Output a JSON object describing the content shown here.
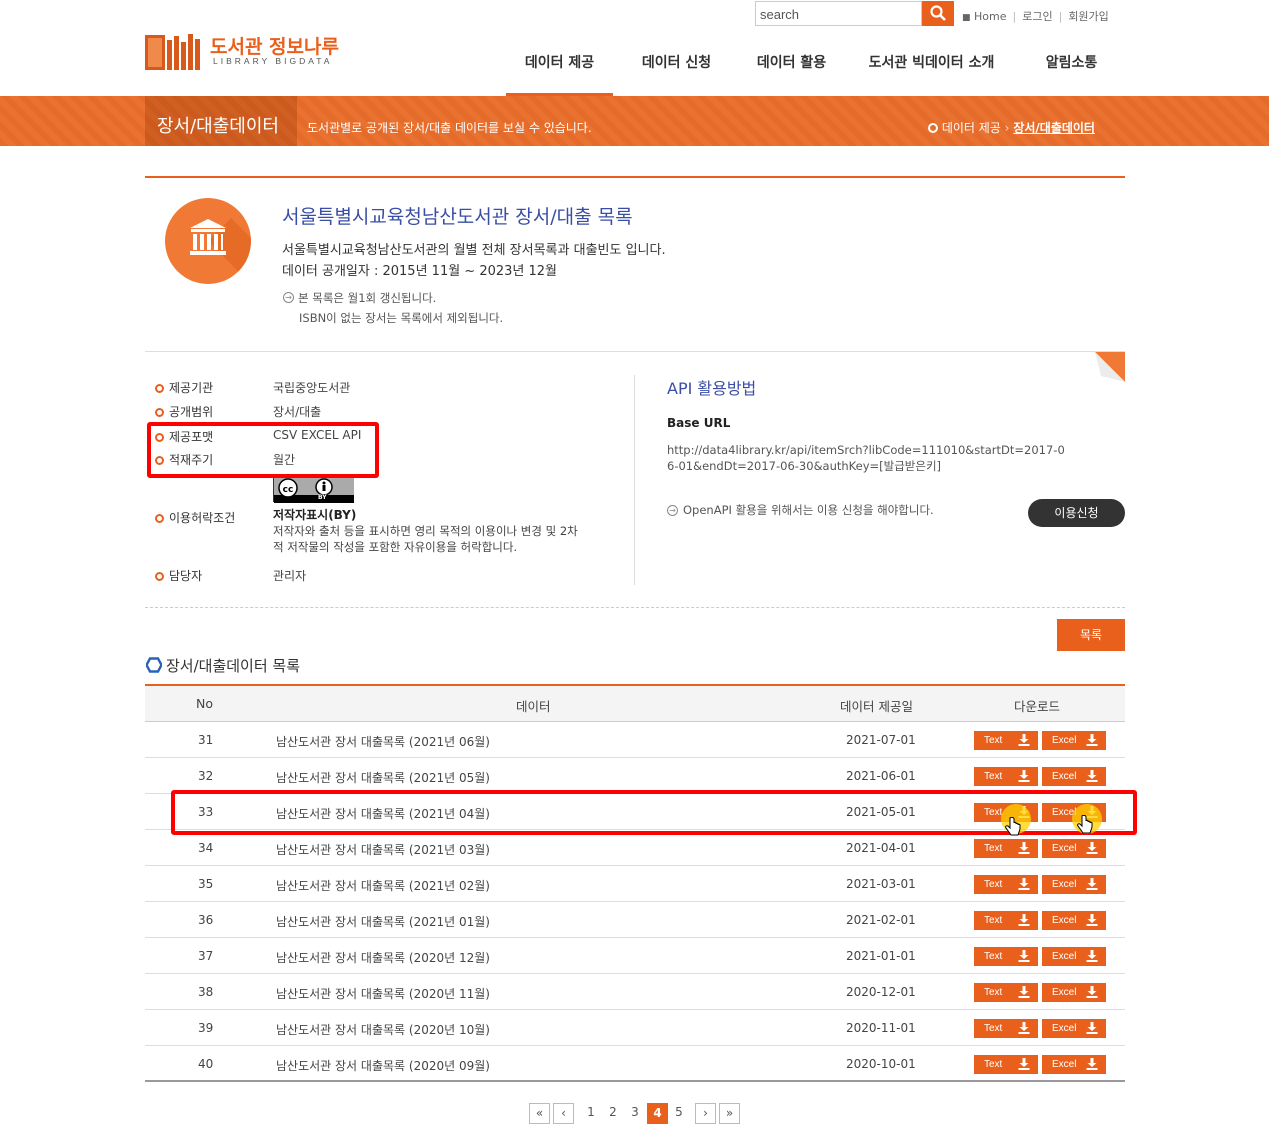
{
  "header": {
    "search_placeholder": "search",
    "util_links": [
      "Home",
      "로그인",
      "회원가입"
    ],
    "logo_title": "도서관 정보나루",
    "logo_sub": "LIBRARY BIGDATA",
    "nav": [
      "데이터 제공",
      "데이터 신청",
      "데이터 활용",
      "도서관 빅데이터 소개",
      "알림소통"
    ],
    "active_nav": "데이터 제공"
  },
  "banner": {
    "title": "장서/대출데이터",
    "desc": "도서관별로 공개된 장서/대출 데이터를 보실 수 있습니다.",
    "crumb_home": "데이터 제공",
    "crumb_current": "장서/대출데이터"
  },
  "dataset": {
    "title": "서울특별시교육청남산도서관 장서/대출 목록",
    "desc1": "서울특별시교육청남산도서관의 월별 전체 장서목록과 대출빈도 입니다.",
    "desc2": "데이터 공개일자 : 2015년 11월 ~ 2023년 12월",
    "note1": "본 목록은 월1회 갱신됩니다.",
    "note2": "ISBN이 없는 장서는 목록에서 제외됩니다."
  },
  "info": {
    "provider_label": "제공기관",
    "provider": "국립중앙도서관",
    "scope_label": "공개범위",
    "scope": "장서/대출",
    "format_label": "제공포맷",
    "format": "CSV EXCEL API",
    "cycle_label": "적재주기",
    "cycle": "월간",
    "license_label": "이용허락조건",
    "license_name": "저작자표시(BY)",
    "license_desc1": "저작자와 출처 등을 표시하면 영리 목적의 이용이나 변경 및 2차",
    "license_desc2": "적 저작물의 작성을 포함한 자유이용을 허락합니다.",
    "cc_by": "BY",
    "manager_label": "담당자",
    "manager": "관리자"
  },
  "api": {
    "title": "API 활용방법",
    "base_url_label": "Base URL",
    "base_url": "http://data4library.kr/api/itemSrch?libCode=111010&startDt=2017-06-01&endDt=2017-06-30&authKey=[발급받은키]",
    "note": "OpenAPI 활용을 위해서는 이용 신청을 해야합니다.",
    "apply_label": "이용신청"
  },
  "list": {
    "button": "목록",
    "title": "장서/대출데이터 목록",
    "headers": [
      "No",
      "데이터",
      "데이터 제공일",
      "다운로드"
    ],
    "text_label": "Text",
    "excel_label": "Excel",
    "rows": [
      {
        "no": "31",
        "name": "남산도서관 장서 대출목록 (2021년 06월)",
        "date": "2021-07-01"
      },
      {
        "no": "32",
        "name": "남산도서관 장서 대출목록 (2021년 05월)",
        "date": "2021-06-01"
      },
      {
        "no": "33",
        "name": "남산도서관 장서 대출목록 (2021년 04월)",
        "date": "2021-05-01"
      },
      {
        "no": "34",
        "name": "남산도서관 장서 대출목록 (2021년 03월)",
        "date": "2021-04-01"
      },
      {
        "no": "35",
        "name": "남산도서관 장서 대출목록 (2021년 02월)",
        "date": "2021-03-01"
      },
      {
        "no": "36",
        "name": "남산도서관 장서 대출목록 (2021년 01월)",
        "date": "2021-02-01"
      },
      {
        "no": "37",
        "name": "남산도서관 장서 대출목록 (2020년 12월)",
        "date": "2021-01-01"
      },
      {
        "no": "38",
        "name": "남산도서관 장서 대출목록 (2020년 11월)",
        "date": "2020-12-01"
      },
      {
        "no": "39",
        "name": "남산도서관 장서 대출목록 (2020년 10월)",
        "date": "2020-11-01"
      },
      {
        "no": "40",
        "name": "남산도서관 장서 대출목록 (2020년 09월)",
        "date": "2020-10-01"
      }
    ]
  },
  "pagination": {
    "pages": [
      "1",
      "2",
      "3",
      "4",
      "5"
    ],
    "current": "4"
  },
  "colors": {
    "accent": "#e8601c",
    "title_blue": "#3b4ea6",
    "highlight_red": "#ff0000"
  }
}
